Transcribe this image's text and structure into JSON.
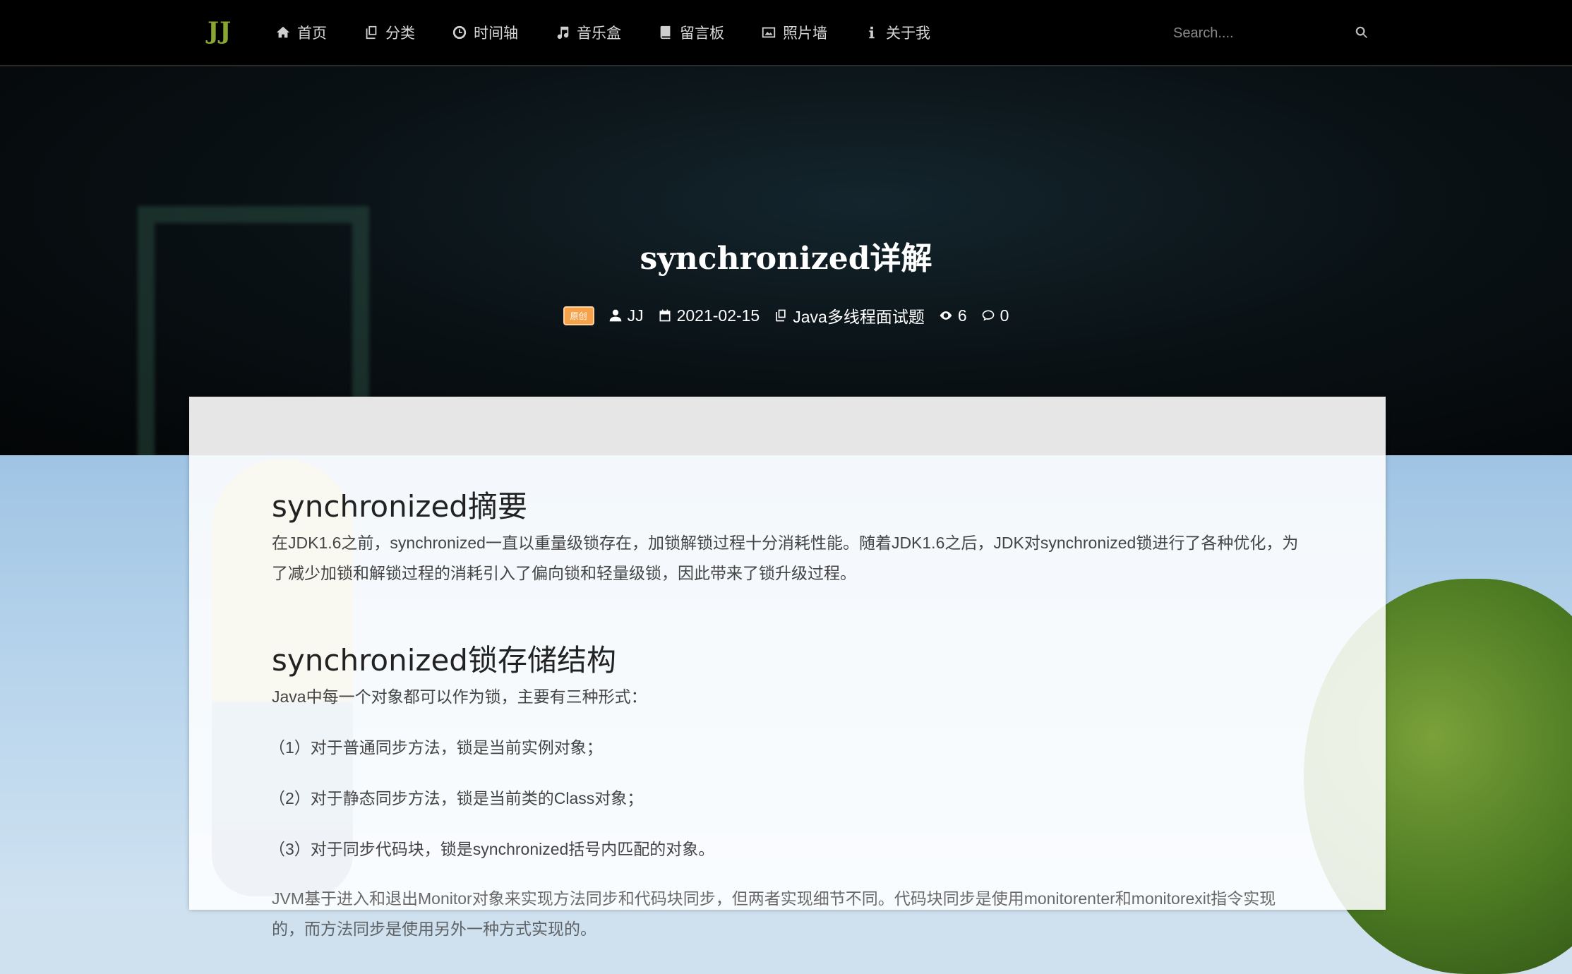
{
  "brand": "JJ",
  "nav": [
    {
      "icon": "home-icon",
      "label": "首页"
    },
    {
      "icon": "copy-icon",
      "label": "分类"
    },
    {
      "icon": "clock-icon",
      "label": "时间轴"
    },
    {
      "icon": "music-icon",
      "label": "音乐盒"
    },
    {
      "icon": "book-icon",
      "label": "留言板"
    },
    {
      "icon": "image-icon",
      "label": "照片墙"
    },
    {
      "icon": "info-icon",
      "label": "关于我"
    }
  ],
  "search": {
    "placeholder": "Search...."
  },
  "post": {
    "title": "synchronized详解",
    "badge": "原创",
    "author": "JJ",
    "date": "2021-02-15",
    "category": "Java多线程面试题",
    "views": "6",
    "comments": "0"
  },
  "article": {
    "heading1": "synchronized摘要",
    "para1": "在JDK1.6之前，synchronized一直以重量级锁存在，加锁解锁过程十分消耗性能。随着JDK1.6之后，JDK对synchronized锁进行了各种优化，为了减少加锁和解锁过程的消耗引入了偏向锁和轻量级锁，因此带来了锁升级过程。",
    "heading2": "synchronized锁存储结构",
    "para2": "Java中每一个对象都可以作为锁，主要有三种形式：",
    "item1": "（1）对于普通同步方法，锁是当前实例对象；",
    "item2": "（2）对于静态同步方法，锁是当前类的Class对象；",
    "item3": "（3）对于同步代码块，锁是synchronized括号内匹配的对象。",
    "para3": "JVM基于进入和退出Monitor对象来实现方法同步和代码块同步，但两者实现细节不同。代码块同步是使用monitorenter和monitorexit指令实现的，而方法同步是使用另外一种方式实现的。"
  }
}
